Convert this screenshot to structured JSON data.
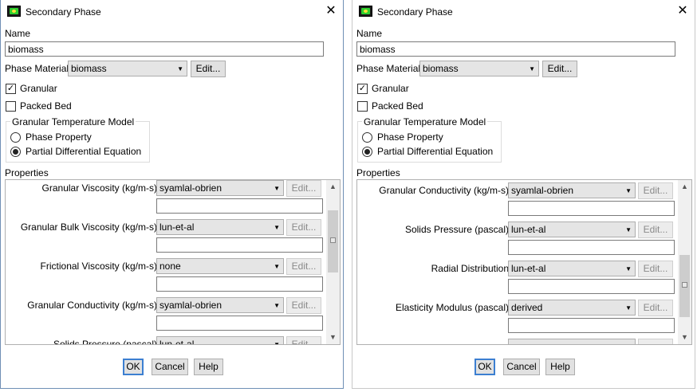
{
  "dialogs": [
    {
      "title": "Secondary Phase",
      "name_label": "Name",
      "name_value": "biomass",
      "phase_material_label": "Phase Material",
      "phase_material_value": "biomass",
      "edit_label": "Edit...",
      "granular_label": "Granular",
      "granular_checked": true,
      "packed_bed_label": "Packed Bed",
      "packed_bed_checked": false,
      "gtm_title": "Granular Temperature Model",
      "gtm_options": [
        "Phase Property",
        "Partial Differential Equation"
      ],
      "gtm_selected": 1,
      "properties_label": "Properties",
      "properties": [
        {
          "label": "Granular Viscosity (kg/m-s)",
          "value": "syamlal-obrien",
          "edit": "Edit..."
        },
        {
          "label": "Granular Bulk Viscosity (kg/m-s)",
          "value": "lun-et-al",
          "edit": "Edit..."
        },
        {
          "label": "Frictional Viscosity (kg/m-s)",
          "value": "none",
          "edit": "Edit..."
        },
        {
          "label": "Granular Conductivity (kg/m-s)",
          "value": "syamlal-obrien",
          "edit": "Edit..."
        },
        {
          "label": "Solids Pressure (pascal)",
          "value": "lun-et-al",
          "edit": "Edit..."
        }
      ],
      "ok_label": "OK",
      "cancel_label": "Cancel",
      "help_label": "Help"
    },
    {
      "title": "Secondary Phase",
      "name_label": "Name",
      "name_value": "biomass",
      "phase_material_label": "Phase Material",
      "phase_material_value": "biomass",
      "edit_label": "Edit...",
      "granular_label": "Granular",
      "granular_checked": true,
      "packed_bed_label": "Packed Bed",
      "packed_bed_checked": false,
      "gtm_title": "Granular Temperature Model",
      "gtm_options": [
        "Phase Property",
        "Partial Differential Equation"
      ],
      "gtm_selected": 1,
      "properties_label": "Properties",
      "properties": [
        {
          "label": "Granular Conductivity (kg/m-s)",
          "value": "syamlal-obrien",
          "edit": "Edit..."
        },
        {
          "label": "Solids Pressure (pascal)",
          "value": "lun-et-al",
          "edit": "Edit..."
        },
        {
          "label": "Radial Distribution",
          "value": "lun-et-al",
          "edit": "Edit..."
        },
        {
          "label": "Elasticity Modulus (pascal)",
          "value": "derived",
          "edit": "Edit..."
        }
      ],
      "ok_label": "OK",
      "cancel_label": "Cancel",
      "help_label": "Help"
    }
  ],
  "icons": {
    "close": "close-icon",
    "dropdown": "chevron-down-icon",
    "scroll_up": "scroll-up-arrow-icon",
    "scroll_down": "scroll-down-arrow-icon",
    "checkmark": "checkmark-icon",
    "app": "fluent-app-icon"
  },
  "colors": {
    "primary_button_border": "#3c7fd1",
    "window_border_active": "#6f8fb5",
    "disabled_text": "#8a8a8a"
  }
}
